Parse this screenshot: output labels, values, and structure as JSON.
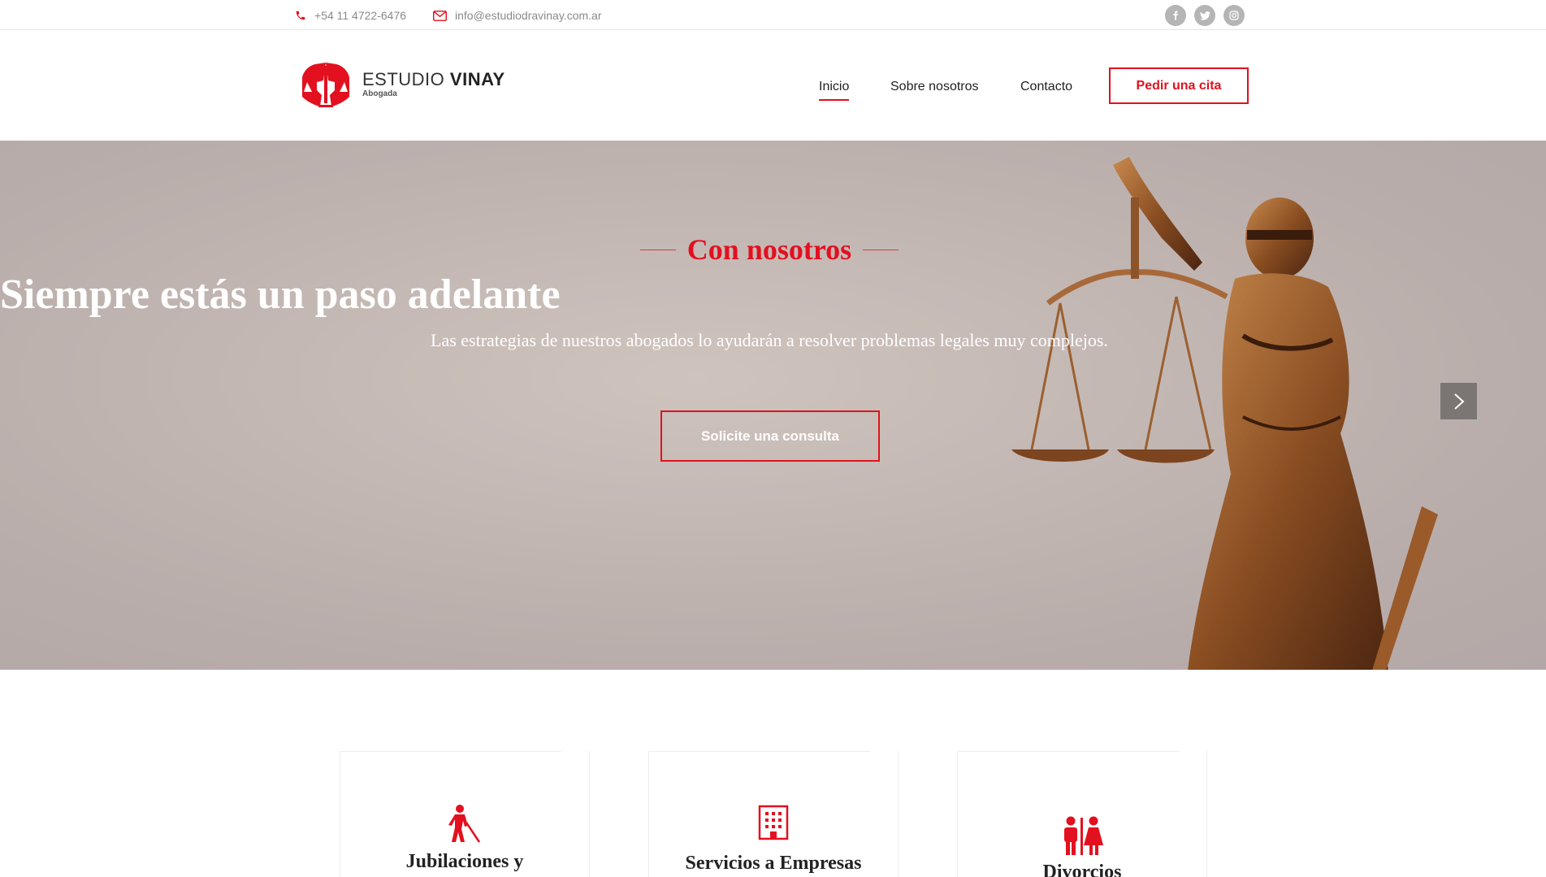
{
  "topbar": {
    "phone": "+54 11 4722-6476",
    "email": "info@estudiodravinay.com.ar",
    "socials": [
      "facebook-icon",
      "twitter-icon",
      "instagram-icon"
    ]
  },
  "header": {
    "logo_word1": "ESTUDIO",
    "logo_word2": "VINAY",
    "logo_sub": "Abogada",
    "nav": [
      {
        "label": "Inicio",
        "active": true
      },
      {
        "label": "Sobre nosotros",
        "active": false
      },
      {
        "label": "Contacto",
        "active": false
      }
    ],
    "cta": "Pedir una cita"
  },
  "hero": {
    "kicker": "Con nosotros",
    "headline": "Siempre estás un paso adelante",
    "subtext": "Las estrategias de nuestros abogados lo ayudarán a resolver problemas legales muy complejos.",
    "button": "Solicite una consulta"
  },
  "services": [
    {
      "title": "Jubilaciones y",
      "icon": "blind-person-icon"
    },
    {
      "title": "Servicios a Empresas",
      "icon": "building-icon"
    },
    {
      "title": "Divorcios",
      "icon": "couple-icon"
    }
  ],
  "colors": {
    "accent": "#e3101f",
    "muted": "#8a8a8a"
  }
}
